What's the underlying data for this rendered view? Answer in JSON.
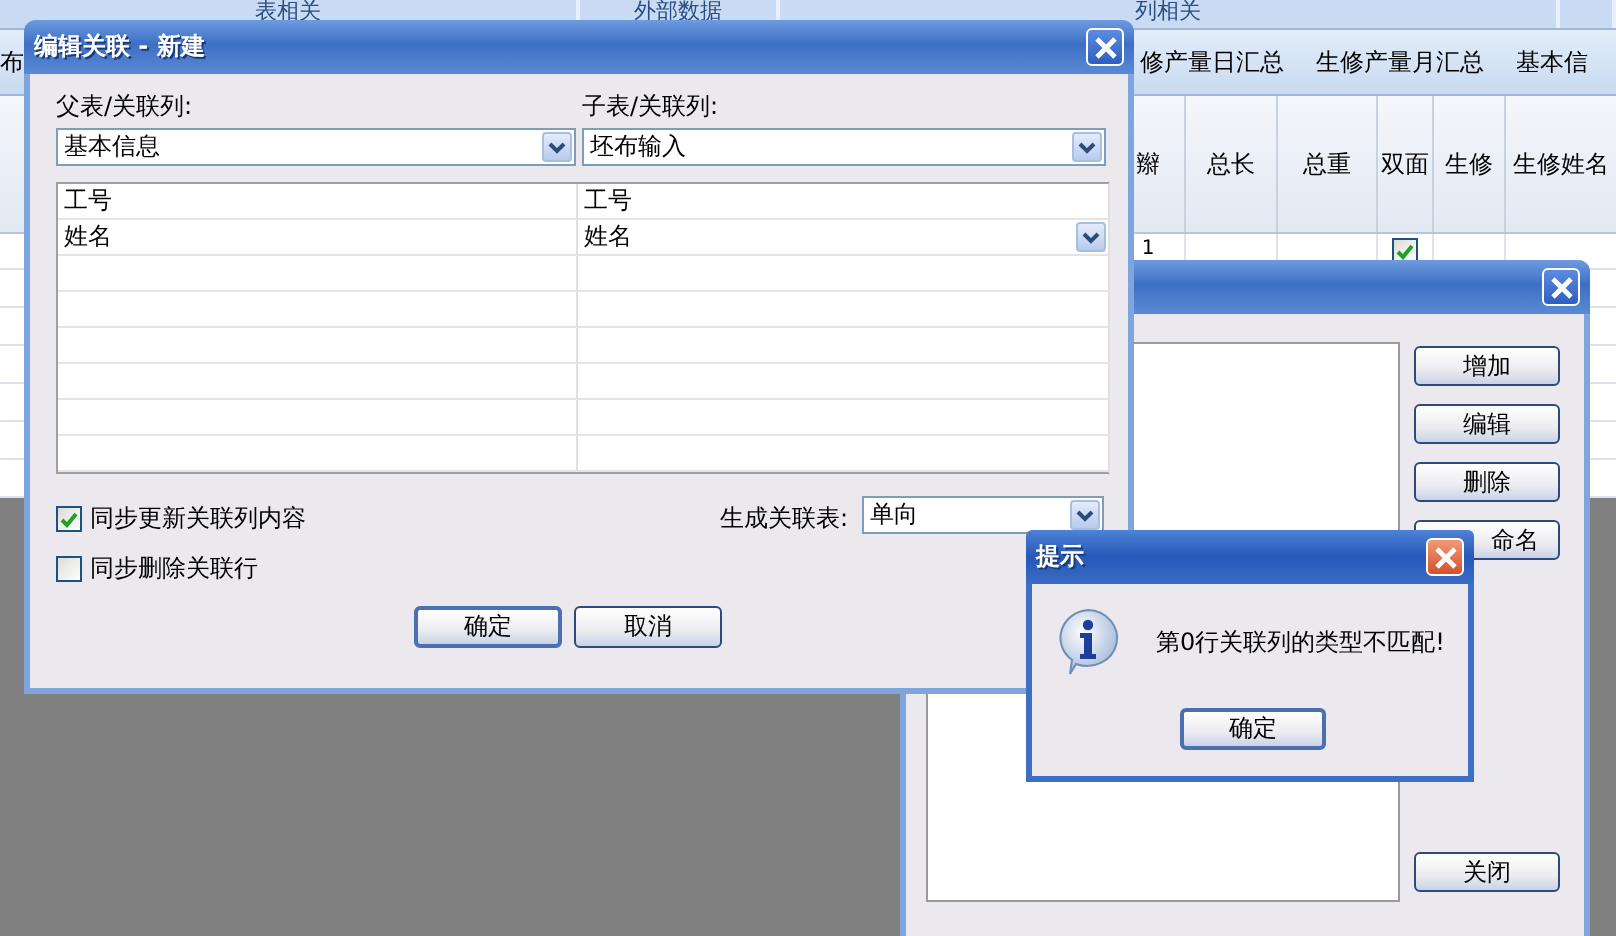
{
  "app": {
    "ribbon_groups": [
      "表相关",
      "外部数据",
      "列相关"
    ],
    "tabs": [
      {
        "label": "布",
        "selected": false
      },
      {
        "label": "修产量日汇总",
        "selected": false
      },
      {
        "label": "生修产量月汇总",
        "selected": false
      },
      {
        "label": "基本信",
        "selected": false
      }
    ],
    "columns": [
      "辮",
      "总长",
      "总重",
      "双面",
      "生修",
      "生修姓名"
    ],
    "rows": [
      {
        "cells": [
          {
            "kind": "text",
            "text": "1"
          },
          {
            "kind": "blank"
          },
          {
            "kind": "blank"
          },
          {
            "kind": "check",
            "checked": true
          },
          {
            "kind": "blank"
          },
          {
            "kind": "blank"
          }
        ]
      }
    ]
  },
  "list_window": {
    "buttons": [
      "增加",
      "编辑",
      "删除",
      "命名",
      "关闭"
    ]
  },
  "edit_dialog": {
    "title": "编辑关联 - 新建",
    "parent_label": "父表/关联列:",
    "parent_value": "基本信息",
    "child_label": "子表/关联列:",
    "child_value": "坯布输入",
    "mappings": [
      {
        "parent": "工号",
        "child": "工号",
        "editing": false
      },
      {
        "parent": "姓名",
        "child": "姓名",
        "editing": true
      }
    ],
    "options": [
      {
        "label": "同步更新关联列内容",
        "checked": true
      },
      {
        "label": "同步删除关联行",
        "checked": false
      }
    ],
    "generate_label": "生成关联表:",
    "generate_value": "单向",
    "buttons": [
      "确定",
      "取消"
    ]
  },
  "message_box": {
    "title": "提示",
    "message": "第0行关联列的类型不匹配!",
    "button": "确定"
  }
}
